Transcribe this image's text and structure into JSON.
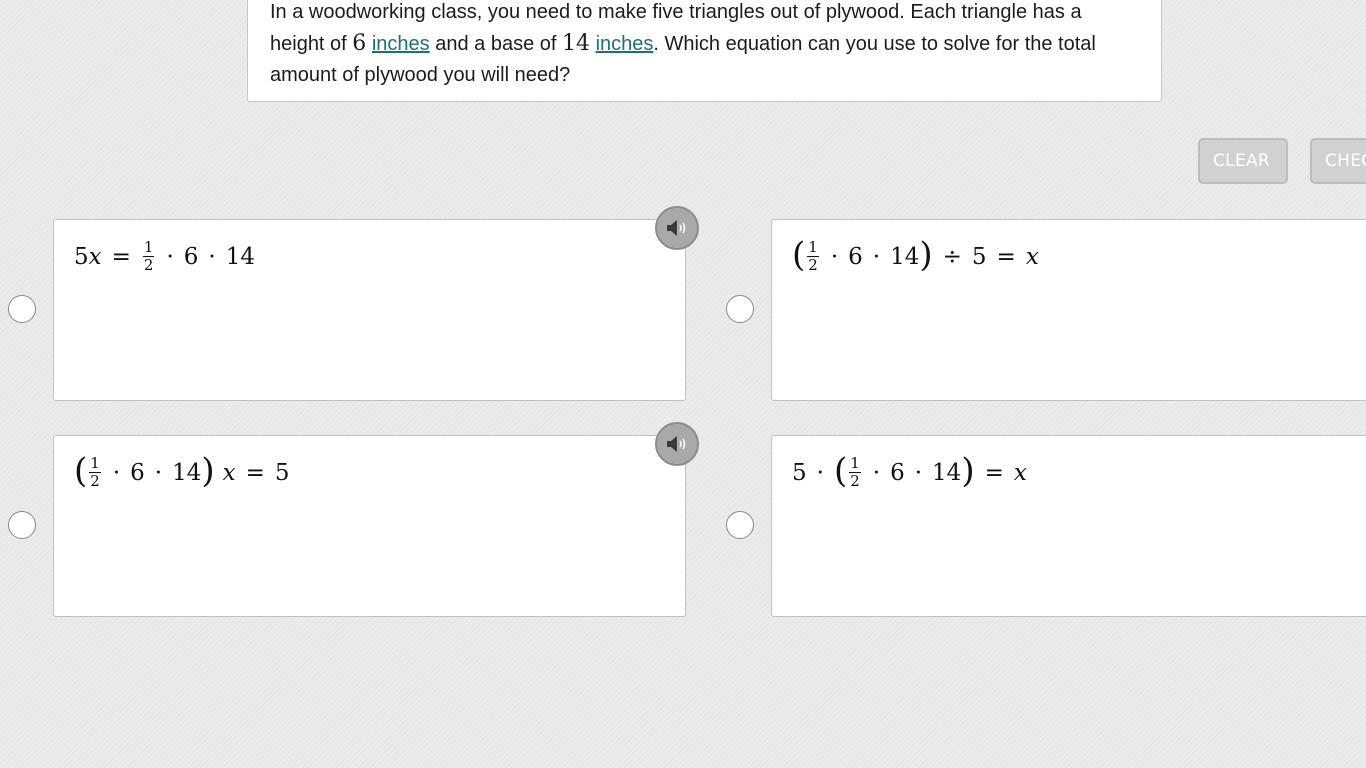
{
  "question": {
    "text_1": "In a woodworking class, you need to make five triangles out of plywood. Each triangle has a height of ",
    "height_value": "6",
    "unit_link_1": "inches",
    "text_2": " and a base of ",
    "base_value": "14",
    "unit_link_2": "inches",
    "text_3": ". Which equation can you use to solve for the total amount of plywood you will need?"
  },
  "actions": {
    "clear_label": "CLEAR",
    "check_label": "CHECK"
  },
  "options": [
    {
      "tokens": {
        "a": "5",
        "x": "x",
        "eq": "=",
        "fn": "1",
        "fd": "2",
        "dot1": "·",
        "n6": "6",
        "dot2": "·",
        "n14": "14"
      },
      "has_audio": true
    },
    {
      "tokens": {
        "lp": "(",
        "fn": "1",
        "fd": "2",
        "dot1": "·",
        "n6": "6",
        "dot2": "·",
        "n14": "14",
        "rp": ")",
        "div": "÷",
        "n5": "5",
        "eq": "=",
        "x": "x"
      },
      "has_audio": false
    },
    {
      "tokens": {
        "lp": "(",
        "fn": "1",
        "fd": "2",
        "dot1": "·",
        "n6": "6",
        "dot2": "·",
        "n14": "14",
        "rp": ")",
        "x": "x",
        "eq": "=",
        "n5": "5"
      },
      "has_audio": true
    },
    {
      "tokens": {
        "n5": "5",
        "dot0": "·",
        "lp": "(",
        "fn": "1",
        "fd": "2",
        "dot1": "·",
        "n6": "6",
        "dot2": "·",
        "n14": "14",
        "rp": ")",
        "eq": "=",
        "x": "x"
      },
      "has_audio": false
    }
  ],
  "icons": {
    "audio": "speaker-icon",
    "radio": "radio-circle"
  },
  "colors": {
    "background": "#e9e9e9",
    "card_border": "#9fd6d4",
    "link": "#1d6f7a",
    "button_bg": "#d1d1d1"
  }
}
